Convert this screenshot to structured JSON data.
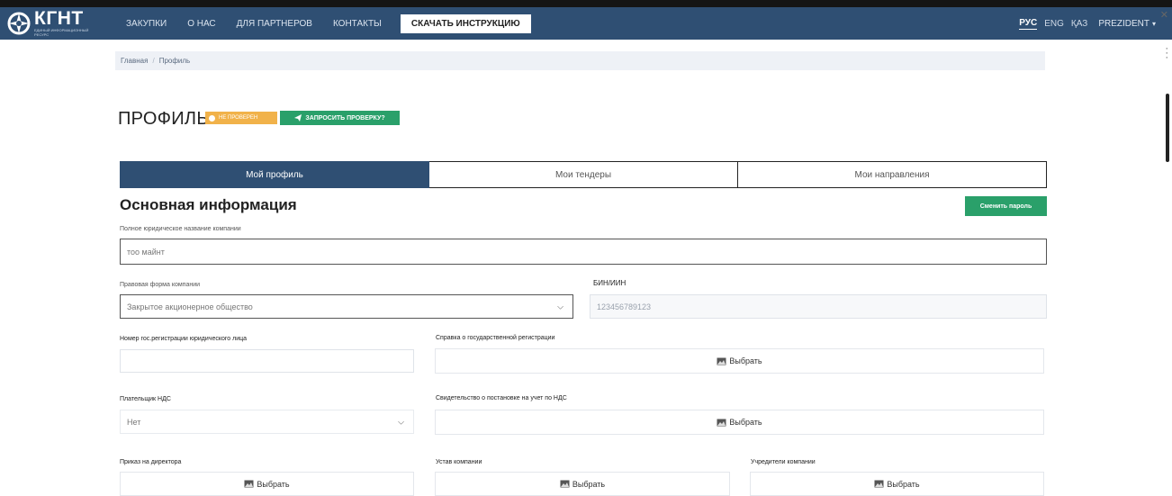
{
  "nav": {
    "logo_text": "КГНТ",
    "logo_subtitle": "ЕДИНЫЙ ИНФОРМАЦИОННЫЙ РЕСУРС",
    "items": [
      "ЗАКУПКИ",
      "О НАС",
      "ДЛЯ ПАРТНЕРОВ",
      "КОНТАКТЫ"
    ],
    "download_button": "СКАЧАТЬ ИНСТРУКЦИЮ",
    "languages": [
      "РУС",
      "ENG",
      "ҚАЗ"
    ],
    "active_language": "РУС",
    "user": "PREZIDENT",
    "close_glyph": "✕"
  },
  "breadcrumb": {
    "home": "Главная",
    "current": "Профиль"
  },
  "header": {
    "title": "ПРОФИЛЬ",
    "status_badge": "НЕ ПРОВЕРЕН",
    "request_button": "ЗАПРОСИТЬ ПРОВЕРКУ?"
  },
  "tabs": [
    "Мой профиль",
    "Мои тендеры",
    "Мои направления"
  ],
  "section": {
    "title": "Основная информация",
    "change_password_button": "Сменить пароль"
  },
  "form": {
    "company_name_label": "Полное юридическое название компании",
    "company_name_value": "тоо майнт",
    "legal_form_label": "Правовая форма компании",
    "legal_form_value": "Закрытое акционерное общество",
    "bin_label": "БИН/ИИН",
    "bin_value": "123456789123",
    "reg_number_label": "Номер гос.регистрации юридического лица",
    "reg_number_value": "",
    "reg_certificate_label": "Справка о государственной регистрации",
    "vat_payer_label": "Плательщик НДС",
    "vat_payer_value": "Нет",
    "vat_certificate_label": "Свидетельство о постановке на учет по НДС",
    "director_order_label": "Приказ на директора",
    "charter_label": "Устав компании",
    "founders_label": "Учредители компании",
    "choose_label": "Выбрать"
  },
  "colors": {
    "navbar": "#2f4f73",
    "accent_green": "#2aa06a",
    "badge_orange": "#f1b24a"
  }
}
